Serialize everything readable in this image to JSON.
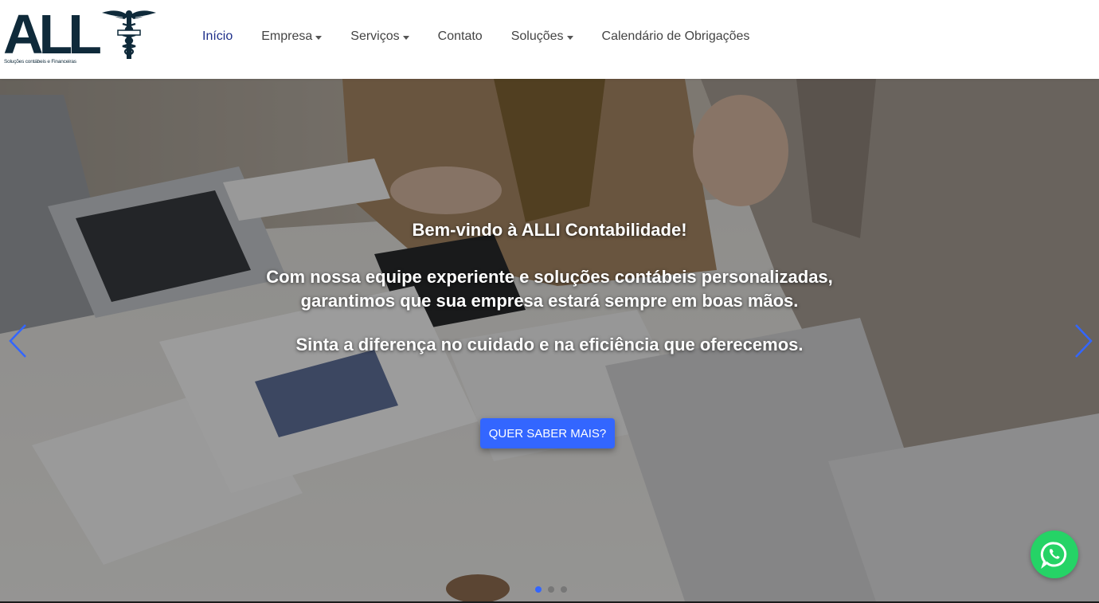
{
  "brand": {
    "logo_text": "ALL",
    "tagline": "Soluções contábeis e Financeiras",
    "emblem": "caduceus-icon"
  },
  "nav": {
    "items": [
      {
        "label": "Início",
        "active": true,
        "dropdown": false
      },
      {
        "label": "Empresa",
        "active": false,
        "dropdown": true
      },
      {
        "label": "Serviços",
        "active": false,
        "dropdown": true
      },
      {
        "label": "Contato",
        "active": false,
        "dropdown": false
      },
      {
        "label": "Soluções",
        "active": false,
        "dropdown": true
      },
      {
        "label": "Calendário de Obrigações",
        "active": false,
        "dropdown": false
      }
    ]
  },
  "hero": {
    "title": "Bem-vindo à ALLI Contabilidade!",
    "line1": "Com nossa equipe experiente e soluções contábeis personalizadas,",
    "line2": "garantimos que sua empresa estará sempre em boas mãos.",
    "line3": "Sinta a diferença no cuidado e na eficiência que oferecemos.",
    "cta_label": "QUER SABER MAIS?",
    "slides_count": 3,
    "active_slide": 1
  },
  "colors": {
    "accent": "#3366ff",
    "nav_active": "#1e2f8a",
    "whatsapp": "#25d366"
  },
  "icons": {
    "prev": "chevron-left-icon",
    "next": "chevron-right-icon",
    "chat": "whatsapp-icon"
  }
}
